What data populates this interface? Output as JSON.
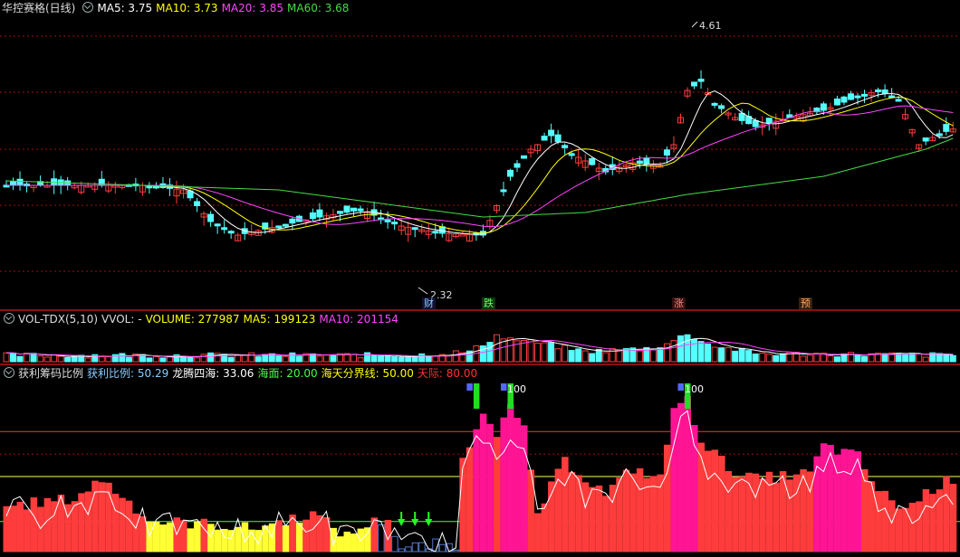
{
  "main": {
    "title": "华控赛格(日线)",
    "ma5": "MA5: 3.75",
    "ma10": "MA10: 3.73",
    "ma20": "MA20: 3.85",
    "ma60": "MA60: 3.68",
    "high_label": "4.61",
    "low_label": "2.32",
    "markers": {
      "cai": "财",
      "die": "跌",
      "zhang": "涨",
      "yu": "预"
    }
  },
  "vol": {
    "title": "VOL-TDX(5,10)",
    "vvol": "VVOL: -",
    "volume": "VOLUME: 277987",
    "ma5": "MA5: 199123",
    "ma10": "MA10: 201154"
  },
  "profit": {
    "title": "获利筹码比例",
    "ratio": "获利比例: 50.29",
    "dragon": "龙腾四海: 33.06",
    "sea": "海面: 20.00",
    "divide": "海天分界线: 50.00",
    "sky": "天际: 80.00",
    "hundred_label": "100"
  },
  "colors": {
    "up": "#ff3c3c",
    "down": "#54ffff",
    "ma5": "#ffffff",
    "ma10": "#ffff00",
    "ma20": "#ff44ff",
    "ma60": "#44dd44",
    "bg": "#000000",
    "grid": "#a01010"
  },
  "chart_data": {
    "type": "candlestick",
    "price_high": 4.61,
    "price_low": 2.32,
    "profit_levels": {
      "sea": 20,
      "divide": 50,
      "sky": 80
    },
    "volume_last": 277987
  }
}
